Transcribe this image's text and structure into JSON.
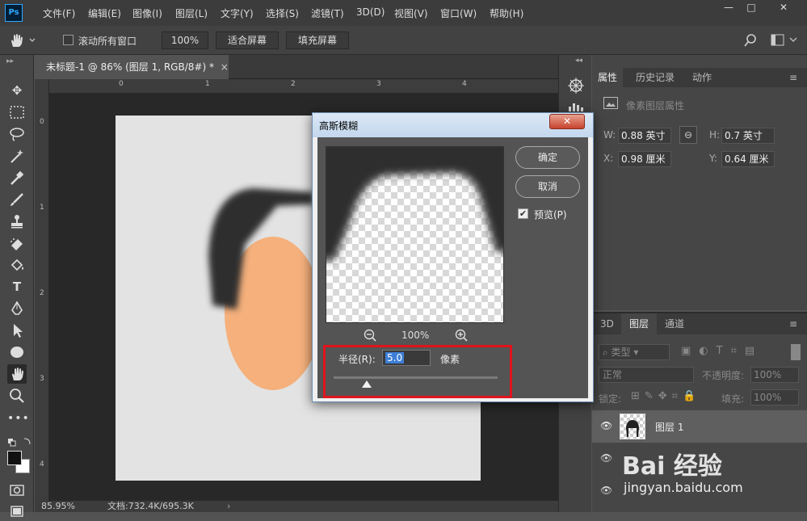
{
  "app": {
    "logo": "Ps"
  },
  "menu": [
    "文件(F)",
    "编辑(E)",
    "图像(I)",
    "图层(L)",
    "文字(Y)",
    "选择(S)",
    "滤镜(T)",
    "3D(D)",
    "视图(V)",
    "窗口(W)",
    "帮助(H)"
  ],
  "window_controls": {
    "minimize": "—",
    "maximize": "□",
    "close": "✕"
  },
  "options": {
    "scroll_all": "滚动所有窗口",
    "zoom": "100%",
    "fit_screen": "适合屏幕",
    "fill_screen": "填充屏幕"
  },
  "document": {
    "tab_title": "未标题-1 @ 86% (图层 1, RGB/8#) *",
    "close": "×",
    "zoom_status": "85.95%",
    "doc_info": "文档:732.4K/695.3K"
  },
  "rulers": {
    "top": [
      "0",
      "1",
      "2",
      "3",
      "4"
    ],
    "left": [
      "0",
      "1",
      "2",
      "3",
      "4"
    ]
  },
  "props": {
    "tabs": [
      "属性",
      "历史记录",
      "动作"
    ],
    "header": "像素图层属性",
    "w_label": "W:",
    "w_value": "0.88 英寸",
    "h_label": "H:",
    "h_value": "0.7 英寸",
    "x_label": "X:",
    "x_value": "0.98 厘米",
    "y_label": "Y:",
    "y_value": "0.64 厘米"
  },
  "layers": {
    "tabs": [
      "3D",
      "图层",
      "通道"
    ],
    "filter_kind": "类型",
    "blend_mode": "正常",
    "opacity_label": "不透明度:",
    "opacity_value": "100%",
    "lock_label": "锁定:",
    "fill_label": "填充:",
    "fill_value": "100%",
    "layer1_name": "图层 1"
  },
  "dialog": {
    "title": "高斯模糊",
    "close": "✕",
    "ok": "确定",
    "cancel": "取消",
    "preview_label": "预览(P)",
    "preview_checked": true,
    "zoom_value": "100%",
    "radius_label": "半径(R):",
    "radius_value": "5.0",
    "radius_unit": "像素",
    "slider_fraction": 0.2
  },
  "watermark": {
    "brand": "Bai  经验",
    "url": "jingyan.baidu.com"
  },
  "colors": {
    "hair": "#2d2d2d",
    "face": "#f5b07c",
    "canvas_bg": "#e3e3e3",
    "highlight": "#e0141b"
  }
}
